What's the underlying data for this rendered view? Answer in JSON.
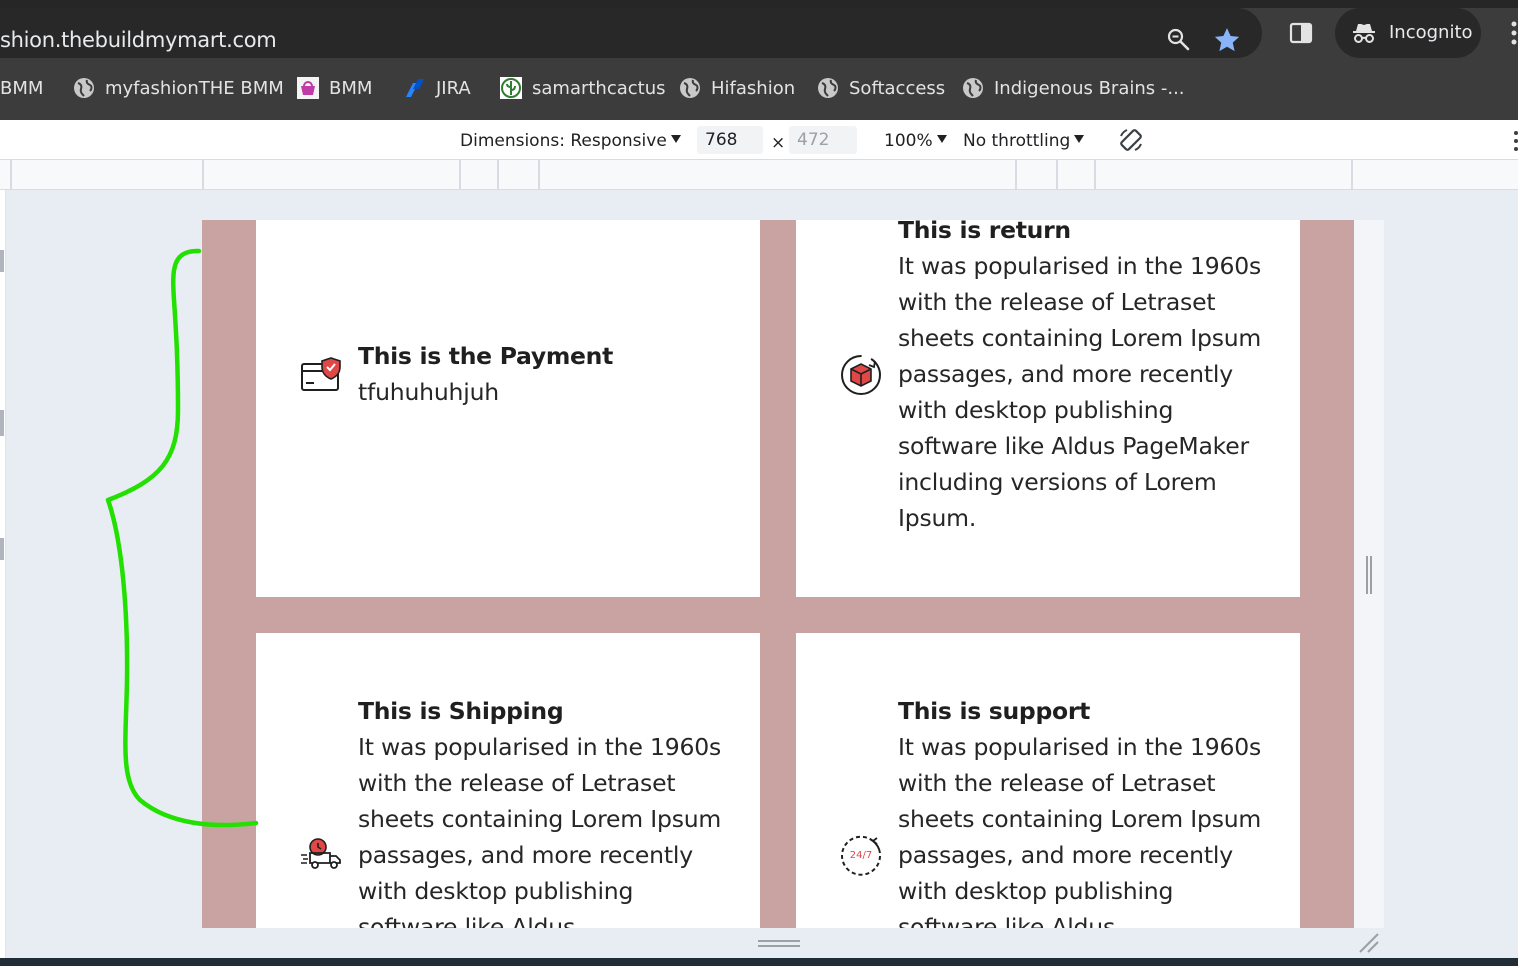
{
  "browser": {
    "url": "shion.thebuildmymart.com",
    "profile": "Incognito",
    "bookmarks": [
      {
        "label": "BMM",
        "icon": "none"
      },
      {
        "label": "myfashionTHE BMM",
        "icon": "globe-icon"
      },
      {
        "label": "BMM",
        "icon": "bmm-logo-icon"
      },
      {
        "label": "JIRA",
        "icon": "jira-icon"
      },
      {
        "label": "samarthcactus",
        "icon": "cactus-icon"
      },
      {
        "label": "Hifashion",
        "icon": "globe-icon"
      },
      {
        "label": "Softaccess",
        "icon": "globe-icon"
      },
      {
        "label": "Indigenous Brains -...",
        "icon": "globe-icon"
      }
    ]
  },
  "devtools": {
    "dimensions_label": "Dimensions: Responsive",
    "width": "768",
    "times": "×",
    "height_placeholder": "472",
    "zoom": "100%",
    "throttling": "No throttling"
  },
  "page": {
    "background_color": "#c9a2a2",
    "cards": [
      {
        "title": "This is the Payment",
        "body": "tfuhuhuhjuh",
        "icon": "payment-card-shield-icon"
      },
      {
        "title": "This is return",
        "body": "It was popularised in the 1960s with the release of Letraset sheets containing Lorem Ipsum passages, and more recently with desktop publishing software like Aldus PageMaker including versions of Lorem Ipsum.",
        "icon": "return-box-icon"
      },
      {
        "title": "This is Shipping",
        "body": "It was popularised in the 1960s with the release of Letraset sheets containing Lorem Ipsum passages, and more recently with desktop publishing software like Aldus",
        "icon": "shipping-truck-icon"
      },
      {
        "title": "This is support",
        "body": "It was popularised in the 1960s with the release of Letraset sheets containing Lorem Ipsum passages, and more recently with desktop publishing software like Aldus",
        "icon": "support-24-7-icon",
        "icon_text": "24/7"
      }
    ]
  },
  "annotation": {
    "color": "#22e000",
    "shape": "curly-brace"
  }
}
